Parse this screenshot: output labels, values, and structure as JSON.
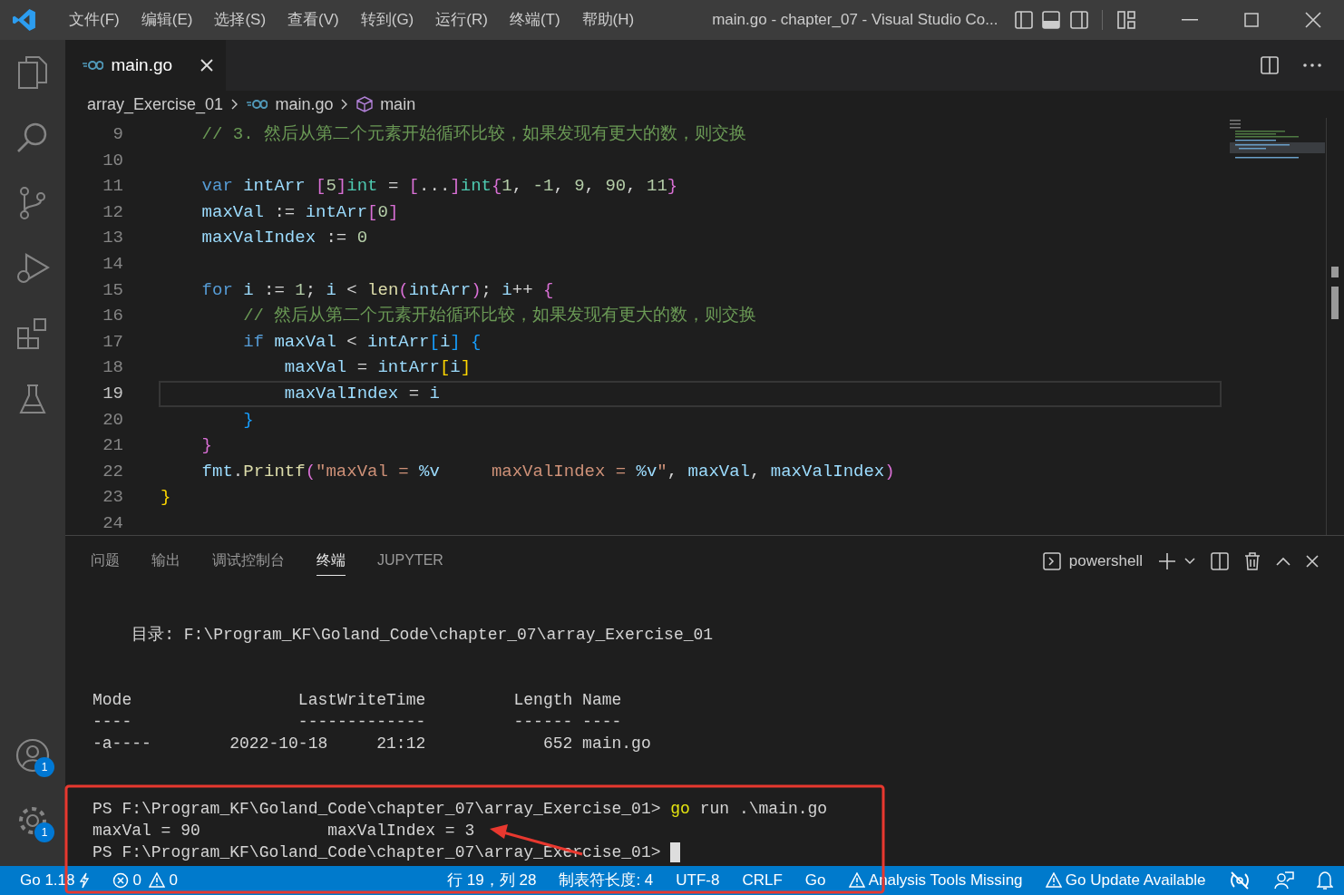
{
  "window": {
    "title": "main.go - chapter_07 - Visual Studio Co..."
  },
  "menu": [
    "文件(F)",
    "编辑(E)",
    "选择(S)",
    "查看(V)",
    "转到(G)",
    "运行(R)",
    "终端(T)",
    "帮助(H)"
  ],
  "activity_bar": {
    "account_badge": "1",
    "settings_badge": "1"
  },
  "tabs": [
    {
      "label": "main.go",
      "selected": true
    }
  ],
  "breadcrumb": [
    "array_Exercise_01",
    "main.go",
    "main"
  ],
  "editor": {
    "lines": [
      {
        "number": "9",
        "current": false,
        "tokens": [
          {
            "kind": "comment",
            "text": "    // 3. 然后从第二个元素开始循环比较，如果发现有更大的数，则交换"
          }
        ]
      },
      {
        "number": "10",
        "current": false
      },
      {
        "number": "11",
        "current": false,
        "tokens": [
          {
            "kind": "keyword",
            "text": "    var "
          },
          {
            "kind": "var",
            "text": "intArr "
          },
          {
            "kind": "b2",
            "text": "["
          },
          {
            "kind": "num",
            "text": "5"
          },
          {
            "kind": "b2",
            "text": "]"
          },
          {
            "kind": "type",
            "text": "int"
          },
          {
            "kind": "plain",
            "text": " = "
          },
          {
            "kind": "b2",
            "text": "["
          },
          {
            "kind": "plain",
            "text": "..."
          },
          {
            "kind": "b2",
            "text": "]"
          },
          {
            "kind": "type",
            "text": "int"
          },
          {
            "kind": "b2",
            "text": "{"
          },
          {
            "kind": "num",
            "text": "1"
          },
          {
            "kind": "plain",
            "text": ", "
          },
          {
            "kind": "num",
            "text": "-1"
          },
          {
            "kind": "plain",
            "text": ", "
          },
          {
            "kind": "num",
            "text": "9"
          },
          {
            "kind": "plain",
            "text": ", "
          },
          {
            "kind": "num",
            "text": "90"
          },
          {
            "kind": "plain",
            "text": ", "
          },
          {
            "kind": "num",
            "text": "11"
          },
          {
            "kind": "b2",
            "text": "}"
          }
        ]
      },
      {
        "number": "12",
        "current": false,
        "tokens": [
          {
            "kind": "var",
            "text": "    maxVal"
          },
          {
            "kind": "plain",
            "text": " := "
          },
          {
            "kind": "var",
            "text": "intArr"
          },
          {
            "kind": "b2",
            "text": "["
          },
          {
            "kind": "num",
            "text": "0"
          },
          {
            "kind": "b2",
            "text": "]"
          }
        ]
      },
      {
        "number": "13",
        "current": false,
        "tokens": [
          {
            "kind": "var",
            "text": "    maxValIndex"
          },
          {
            "kind": "plain",
            "text": " := "
          },
          {
            "kind": "num",
            "text": "0"
          }
        ]
      },
      {
        "number": "14",
        "current": false
      },
      {
        "number": "15",
        "current": false,
        "tokens": [
          {
            "kind": "keyword",
            "text": "    for "
          },
          {
            "kind": "var",
            "text": "i"
          },
          {
            "kind": "plain",
            "text": " := "
          },
          {
            "kind": "num",
            "text": "1"
          },
          {
            "kind": "plain",
            "text": "; "
          },
          {
            "kind": "var",
            "text": "i"
          },
          {
            "kind": "plain",
            "text": " < "
          },
          {
            "kind": "func",
            "text": "len"
          },
          {
            "kind": "b2",
            "text": "("
          },
          {
            "kind": "var",
            "text": "intArr"
          },
          {
            "kind": "b2",
            "text": ")"
          },
          {
            "kind": "plain",
            "text": "; "
          },
          {
            "kind": "var",
            "text": "i"
          },
          {
            "kind": "plain",
            "text": "++ "
          },
          {
            "kind": "b2",
            "text": "{"
          }
        ]
      },
      {
        "number": "16",
        "current": false,
        "tokens": [
          {
            "kind": "comment",
            "text": "        // 然后从第二个元素开始循环比较，如果发现有更大的数，则交换"
          }
        ]
      },
      {
        "number": "17",
        "current": false,
        "tokens": [
          {
            "kind": "keyword",
            "text": "        if "
          },
          {
            "kind": "var",
            "text": "maxVal"
          },
          {
            "kind": "plain",
            "text": " < "
          },
          {
            "kind": "var",
            "text": "intArr"
          },
          {
            "kind": "b3",
            "text": "["
          },
          {
            "kind": "var",
            "text": "i"
          },
          {
            "kind": "b3",
            "text": "] {"
          }
        ]
      },
      {
        "number": "18",
        "current": false,
        "tokens": [
          {
            "kind": "var",
            "text": "            maxVal"
          },
          {
            "kind": "plain",
            "text": " = "
          },
          {
            "kind": "var",
            "text": "intArr"
          },
          {
            "kind": "b1",
            "text": "["
          },
          {
            "kind": "var",
            "text": "i"
          },
          {
            "kind": "b1",
            "text": "]"
          }
        ]
      },
      {
        "number": "19",
        "current": true,
        "tokens": [
          {
            "kind": "var",
            "text": "            maxValIndex"
          },
          {
            "kind": "plain",
            "text": " = "
          },
          {
            "kind": "var",
            "text": "i"
          }
        ]
      },
      {
        "number": "20",
        "current": false,
        "tokens": [
          {
            "kind": "b3",
            "text": "        }"
          }
        ]
      },
      {
        "number": "21",
        "current": false,
        "tokens": [
          {
            "kind": "b2",
            "text": "    }"
          }
        ]
      },
      {
        "number": "22",
        "current": false,
        "tokens": [
          {
            "kind": "var",
            "text": "    fmt"
          },
          {
            "kind": "plain",
            "text": "."
          },
          {
            "kind": "func",
            "text": "Printf"
          },
          {
            "kind": "b2",
            "text": "("
          },
          {
            "kind": "string",
            "text": "\"maxVal = "
          },
          {
            "kind": "var",
            "text": "%v"
          },
          {
            "kind": "string",
            "text": "     maxValIndex = "
          },
          {
            "kind": "var",
            "text": "%v"
          },
          {
            "kind": "string",
            "text": "\""
          },
          {
            "kind": "plain",
            "text": ", "
          },
          {
            "kind": "var",
            "text": "maxVal"
          },
          {
            "kind": "plain",
            "text": ", "
          },
          {
            "kind": "var",
            "text": "maxValIndex"
          },
          {
            "kind": "b2",
            "text": ")"
          }
        ]
      },
      {
        "number": "23",
        "current": false,
        "tokens": [
          {
            "kind": "b1",
            "text": "}"
          }
        ]
      },
      {
        "number": "24",
        "current": false
      }
    ]
  },
  "panel": {
    "tabs": [
      {
        "label": "问题",
        "selected": false
      },
      {
        "label": "输出",
        "selected": false
      },
      {
        "label": "调试控制台",
        "selected": false
      },
      {
        "label": "终端",
        "selected": true
      },
      {
        "label": "JUPYTER",
        "selected": false
      }
    ],
    "shell": "powershell"
  },
  "terminal": {
    "blocks": [
      [
        {
          "tokens": [
            {
              "kind": "plain",
              "text": "    目录: F:\\Program_KF\\Goland_Code\\chapter_07\\array_Exercise_01"
            }
          ]
        }
      ],
      [
        {
          "tokens": [
            {
              "kind": "plain",
              "text": "Mode                 LastWriteTime         Length Name"
            }
          ]
        },
        {
          "tokens": [
            {
              "kind": "plain",
              "text": "----                 -------------         ------ ----"
            }
          ]
        },
        {
          "tokens": [
            {
              "kind": "plain",
              "text": "-a----        2022-10-18     21:12            652 main.go"
            }
          ]
        }
      ],
      [
        {
          "tokens": [
            {
              "kind": "plain",
              "text": "PS F:\\Program_KF\\Goland_Code\\chapter_07\\array_Exercise_01> "
            },
            {
              "kind": "command",
              "text": "go"
            },
            {
              "kind": "plain",
              "text": " run .\\main.go"
            }
          ]
        },
        {
          "tokens": [
            {
              "kind": "plain",
              "text": "maxVal = 90             maxValIndex = 3"
            }
          ]
        },
        {
          "tokens": [
            {
              "kind": "plain",
              "text": "PS F:\\Program_KF\\Goland_Code\\chapter_07\\array_Exercise_01> "
            }
          ],
          "cursor": true
        }
      ]
    ]
  },
  "status_bar": {
    "left": [
      {
        "kind": "go",
        "text": "Go 1.18"
      },
      {
        "kind": "problems",
        "errors": "0",
        "warnings": "0"
      }
    ],
    "right": [
      {
        "kind": "text",
        "text": "行 19，列 28"
      },
      {
        "kind": "text",
        "text": "制表符长度: 4"
      },
      {
        "kind": "text",
        "text": "UTF-8"
      },
      {
        "kind": "text",
        "text": "CRLF"
      },
      {
        "kind": "text",
        "text": "Go"
      },
      {
        "kind": "warning",
        "text": "Analysis Tools Missing"
      },
      {
        "kind": "warning",
        "text": "Go Update Available"
      }
    ]
  }
}
